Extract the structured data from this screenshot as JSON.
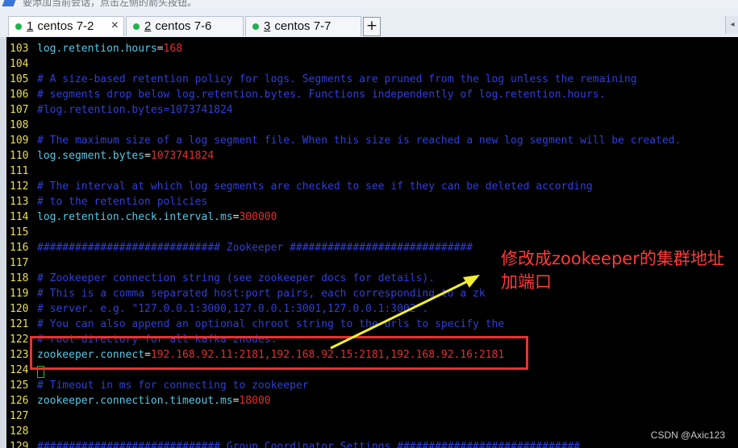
{
  "topbar": {
    "hint": "要添加当前会话，点击左侧的箭头按钮。"
  },
  "tabs": [
    {
      "num": "1",
      "title": "centos 7-2",
      "active": true,
      "close": "×"
    },
    {
      "num": "2",
      "title": "centos 7-6",
      "active": false,
      "close": ""
    },
    {
      "num": "3",
      "title": "centos 7-7",
      "active": false,
      "close": ""
    }
  ],
  "tab_add_label": "+",
  "tab_scroll_label": "◂",
  "terminal_lines": [
    {
      "n": "103",
      "parts": [
        [
          "key",
          "log.retention.hours"
        ],
        [
          "eq",
          "="
        ],
        [
          "val",
          "168"
        ]
      ]
    },
    {
      "n": "104",
      "parts": []
    },
    {
      "n": "105",
      "parts": [
        [
          "cmt",
          "# A size-based retention policy for logs. Segments are pruned from the log unless the remaining"
        ]
      ]
    },
    {
      "n": "106",
      "parts": [
        [
          "cmt",
          "# segments drop below log.retention.bytes. Functions independently of log.retention.hours."
        ]
      ]
    },
    {
      "n": "107",
      "parts": [
        [
          "cmt",
          "#log.retention.bytes=1073741824"
        ]
      ]
    },
    {
      "n": "108",
      "parts": []
    },
    {
      "n": "109",
      "parts": [
        [
          "cmt",
          "# The maximum size of a log segment file. When this size is reached a new log segment will be created."
        ]
      ]
    },
    {
      "n": "110",
      "parts": [
        [
          "key",
          "log.segment.bytes"
        ],
        [
          "eq",
          "="
        ],
        [
          "val",
          "1073741824"
        ]
      ]
    },
    {
      "n": "111",
      "parts": []
    },
    {
      "n": "112",
      "parts": [
        [
          "cmt",
          "# The interval at which log segments are checked to see if they can be deleted according"
        ]
      ]
    },
    {
      "n": "113",
      "parts": [
        [
          "cmt",
          "# to the retention policies"
        ]
      ]
    },
    {
      "n": "114",
      "parts": [
        [
          "key",
          "log.retention.check.interval.ms"
        ],
        [
          "eq",
          "="
        ],
        [
          "val",
          "300000"
        ]
      ]
    },
    {
      "n": "115",
      "parts": []
    },
    {
      "n": "116",
      "parts": [
        [
          "cmt",
          "############################# Zookeeper #############################"
        ]
      ]
    },
    {
      "n": "117",
      "parts": []
    },
    {
      "n": "118",
      "parts": [
        [
          "cmt",
          "# Zookeeper connection string (see zookeeper docs for details)."
        ]
      ]
    },
    {
      "n": "119",
      "parts": [
        [
          "cmt",
          "# This is a comma separated host:port pairs, each corresponding to a zk"
        ]
      ]
    },
    {
      "n": "120",
      "parts": [
        [
          "cmt",
          "# server. e.g. \"127.0.0.1:3000,127.0.0.1:3001,127.0.0.1:3002\"."
        ]
      ]
    },
    {
      "n": "121",
      "parts": [
        [
          "cmt",
          "# You can also append an optional chroot string to the urls to specify the"
        ]
      ]
    },
    {
      "n": "122",
      "parts": [
        [
          "cmt",
          "# root directory for all kafka znodes."
        ]
      ]
    },
    {
      "n": "123",
      "parts": [
        [
          "key",
          "zookeeper.connect"
        ],
        [
          "eq",
          "="
        ],
        [
          "val",
          "192.168.92.11:2181,192.168.92.15:2181,192.168.92.16:2181"
        ]
      ]
    },
    {
      "n": "124",
      "parts": []
    },
    {
      "n": "125",
      "parts": [
        [
          "cmt",
          "# Timeout in ms for connecting to zookeeper"
        ]
      ]
    },
    {
      "n": "126",
      "parts": [
        [
          "key",
          "zookeeper.connection.timeout.ms"
        ],
        [
          "eq",
          "="
        ],
        [
          "val",
          "18000"
        ]
      ]
    },
    {
      "n": "127",
      "parts": []
    },
    {
      "n": "128",
      "parts": []
    },
    {
      "n": "129",
      "parts": [
        [
          "cmt",
          "############################# Group Coordinator Settings #############################"
        ]
      ]
    }
  ],
  "annotation": {
    "text": "修改成zookeeper的集群地址加端口"
  },
  "colors": {
    "annotation": "#ff3a3a",
    "arrow": "#f2ee32",
    "highlight": "#ef2f2f",
    "key": "#55c8e6",
    "value": "#e32e2e",
    "comment": "#2f3fd8",
    "line_number": "#e8de56"
  },
  "watermark": "CSDN @Axic123"
}
